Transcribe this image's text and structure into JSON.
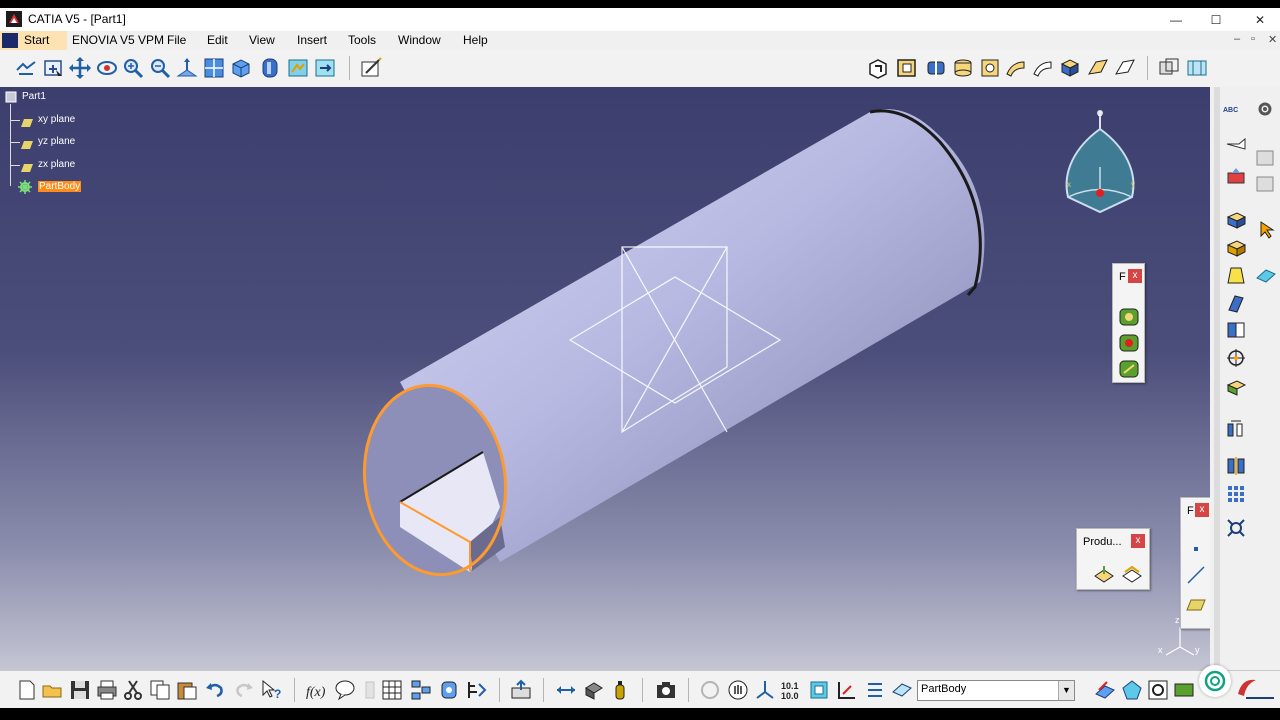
{
  "window": {
    "title": "CATIA V5 - [Part1]",
    "minimize": "—",
    "maximize": "☐",
    "close": "✕"
  },
  "menu": {
    "items": [
      "Start",
      "ENOVIA V5 VPM",
      "File",
      "Edit",
      "View",
      "Insert",
      "Tools",
      "Window",
      "Help"
    ],
    "mdi_minimize": "–",
    "mdi_restore": "▫",
    "mdi_close": "✕"
  },
  "tree": {
    "root": "Part1",
    "items": [
      "xy plane",
      "yz plane",
      "zx plane",
      "PartBody"
    ]
  },
  "compass_labels": {
    "z": "z",
    "x": "x",
    "y": "y"
  },
  "panels": {
    "panel1": {
      "title": "F",
      "close": "x"
    },
    "panel2": {
      "title": "F",
      "close": "x"
    },
    "panel3": {
      "title": "Produ...",
      "close": "x"
    }
  },
  "axis_triad": {
    "z": "z",
    "x": "x",
    "y": "y"
  },
  "bottom": {
    "combo_value": "PartBody",
    "combo_arrow": "▼"
  },
  "colors": {
    "accent": "#ff9a2e",
    "viewport_top": "#3c3e6e",
    "viewport_bottom": "#c4c5d3",
    "tree_highlight": "#ff8c1a"
  },
  "icons": {
    "top_left": [
      "fly-icon",
      "fit-all-icon",
      "pan-icon",
      "rotate-icon",
      "zoom-in-icon",
      "zoom-out-icon",
      "normal-view-icon",
      "multi-view-icon",
      "iso-view-icon",
      "shading-icon",
      "hide-show-icon",
      "swap-space-icon",
      "sketcher-icon"
    ],
    "top_right": [
      "pad-icon",
      "pocket-icon",
      "shaft-icon",
      "groove-icon",
      "hole-icon",
      "rib-icon",
      "slot-icon",
      "stiffener-icon",
      "loft-icon",
      "remove-loft-icon",
      "boolean-icon",
      "assemble-icon"
    ],
    "bottom": [
      "new-icon",
      "open-icon",
      "save-icon",
      "print-icon",
      "cut-icon",
      "copy-icon",
      "paste-icon",
      "undo-icon",
      "redo-icon",
      "whats-this-icon",
      "formula-icon",
      "knowledge-icon",
      "table-icon",
      "catalog-icon",
      "measure-icon",
      "apply-material-icon",
      "snapshot-icon"
    ]
  }
}
